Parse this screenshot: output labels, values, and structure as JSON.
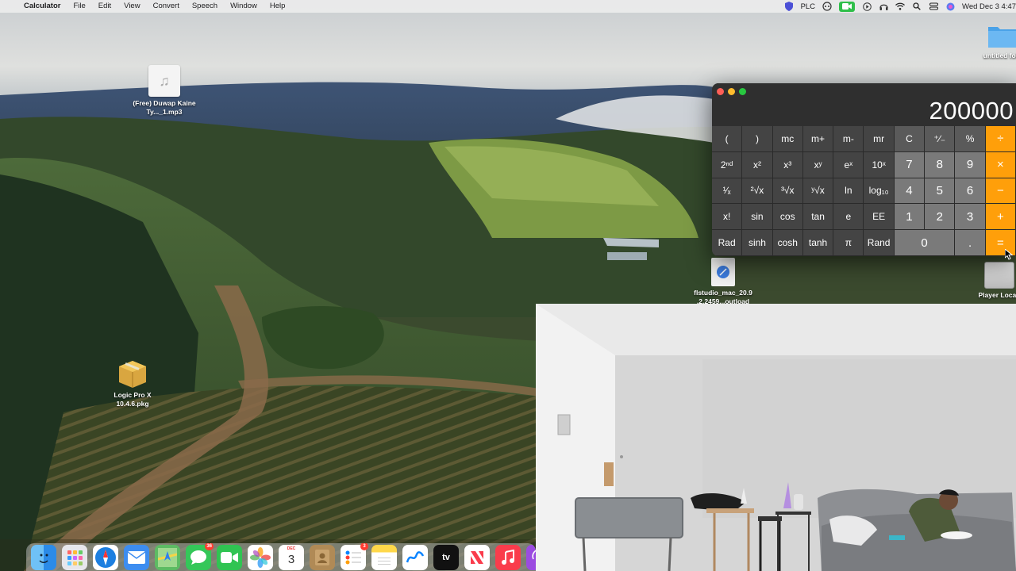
{
  "menubar": {
    "app_name": "Calculator",
    "menus": [
      "File",
      "Edit",
      "View",
      "Convert",
      "Speech",
      "Window",
      "Help"
    ],
    "status_plc": "PLC",
    "clock": "Wed Dec 3  4:47"
  },
  "desktop": {
    "icons": [
      {
        "label": "(Free) Duwap Kaine Ty..._1.mp3",
        "icon": "audio-file-icon"
      },
      {
        "label": "Logic Pro X 10.4.6.pkg",
        "icon": "package-icon"
      },
      {
        "label": "untitled fold",
        "icon": "folder-icon"
      },
      {
        "label": "flstudio_mac_20.9 .2.2459...outload",
        "icon": "disk-image-icon"
      },
      {
        "label": "Player Locati",
        "icon": "drive-icon"
      }
    ]
  },
  "calculator": {
    "display": "200000",
    "keys": [
      [
        "(",
        ")",
        "mc",
        "m+",
        "m-",
        "mr",
        "C",
        "⁺∕₋",
        "%",
        "÷"
      ],
      [
        "2ⁿᵈ",
        "x²",
        "x³",
        "xʸ",
        "eˣ",
        "10ˣ",
        "7",
        "8",
        "9",
        "×"
      ],
      [
        "¹∕ₓ",
        "²√x",
        "³√x",
        "ʸ√x",
        "ln",
        "log₁₀",
        "4",
        "5",
        "6",
        "−"
      ],
      [
        "x!",
        "sin",
        "cos",
        "tan",
        "e",
        "EE",
        "1",
        "2",
        "3",
        "+"
      ],
      [
        "Rad",
        "sinh",
        "cosh",
        "tanh",
        "π",
        "Rand",
        "0",
        ".",
        "="
      ]
    ]
  },
  "dock": {
    "apps": [
      {
        "name": "Finder",
        "icon": "finder-icon",
        "color": "#2b8be8"
      },
      {
        "name": "Launchpad",
        "icon": "launchpad-icon",
        "color": "#e7e7ec"
      },
      {
        "name": "Safari",
        "icon": "safari-icon",
        "color": "#1c7fe0"
      },
      {
        "name": "Mail",
        "icon": "mail-icon",
        "color": "#3d8df0"
      },
      {
        "name": "Maps",
        "icon": "maps-icon",
        "color": "#5dbb63"
      },
      {
        "name": "Messages",
        "icon": "messages-icon",
        "color": "#34c759",
        "badge": "36"
      },
      {
        "name": "FaceTime",
        "icon": "facetime-icon",
        "color": "#30c452"
      },
      {
        "name": "Photos",
        "icon": "photos-icon",
        "color": "#ffffff"
      },
      {
        "name": "Calendar",
        "icon": "calendar-icon",
        "color": "#ffffff",
        "month": "DEC",
        "day": "3"
      },
      {
        "name": "Contacts",
        "icon": "contacts-icon",
        "color": "#b08a56"
      },
      {
        "name": "Reminders",
        "icon": "reminders-icon",
        "color": "#ffffff",
        "badge": "3"
      },
      {
        "name": "Notes",
        "icon": "notes-icon",
        "color": "#ffd84a"
      },
      {
        "name": "Freeform",
        "icon": "freeform-icon",
        "color": "#ffffff"
      },
      {
        "name": "TV",
        "icon": "tv-icon",
        "color": "#111111",
        "text": "tv"
      },
      {
        "name": "News",
        "icon": "news-icon",
        "color": "#ffffff"
      },
      {
        "name": "Music",
        "icon": "music-icon",
        "color": "#fa3c4c"
      },
      {
        "name": "Podcasts",
        "icon": "podcasts-icon",
        "color": "#9b4be0"
      }
    ]
  },
  "colors": {
    "calc_op": "#ff9f0a",
    "calc_num": "#7a7a7a",
    "calc_fn": "#5a5a5a",
    "calc_sci": "#444444"
  }
}
